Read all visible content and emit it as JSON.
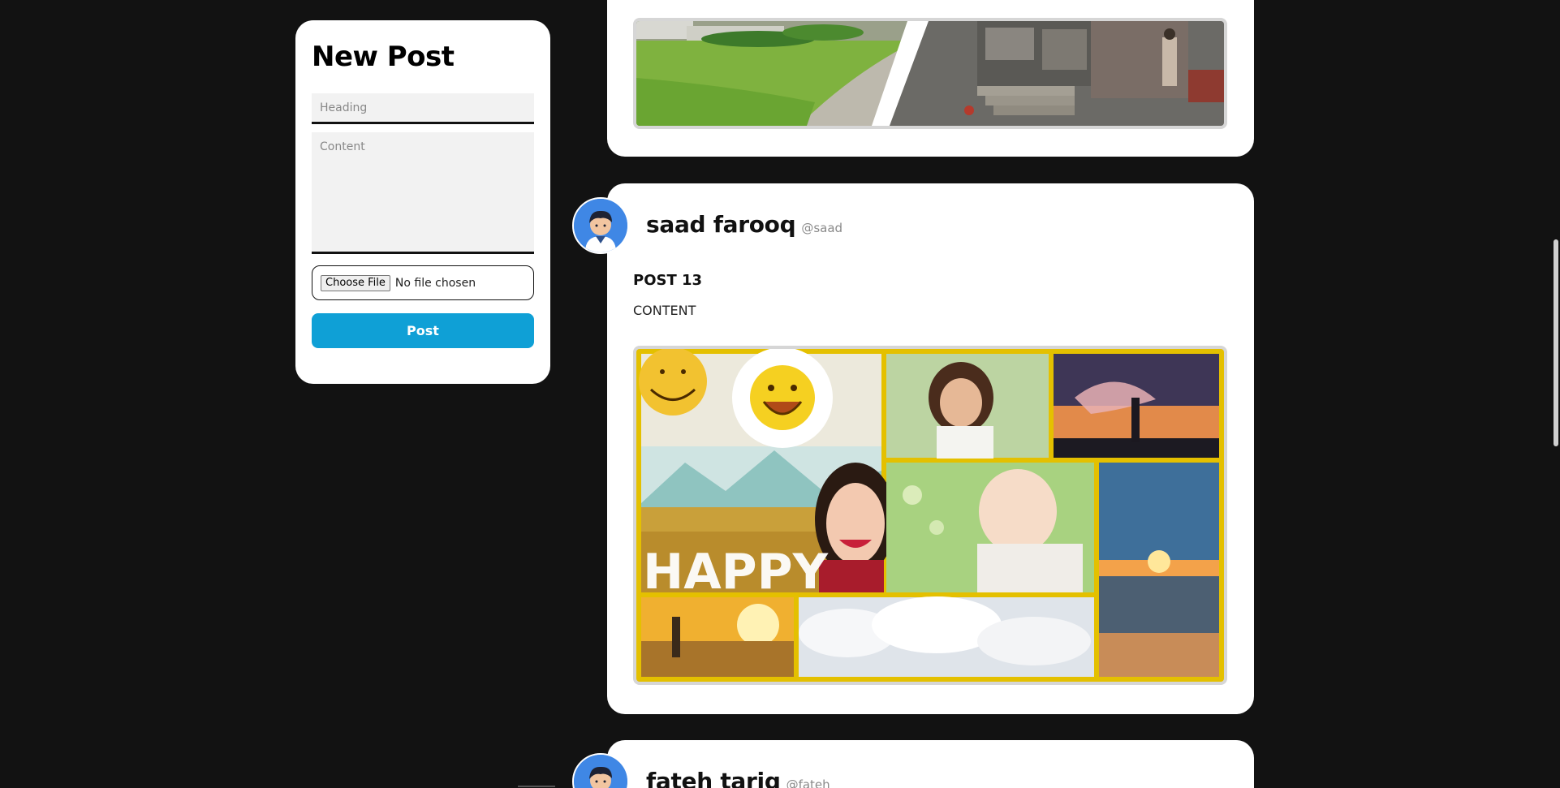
{
  "new_post": {
    "title": "New Post",
    "heading_placeholder": "Heading",
    "content_placeholder": "Content",
    "file_button_label": "Choose File",
    "file_status": "No file chosen",
    "post_button_label": "Post"
  },
  "feed": {
    "posts": [
      {
        "author_name": "saad farooq",
        "author_handle": "@saad",
        "heading": "POST 13",
        "content": "CONTENT",
        "image_caption_text": "HAPPY"
      },
      {
        "author_name": "fateh tariq",
        "author_handle": "@fateh"
      }
    ]
  },
  "colors": {
    "page_background": "#121212",
    "card_background": "#ffffff",
    "post_button": "#0fa0d6",
    "avatar_background": "#3f87e5",
    "collage_border": "#e4c000"
  },
  "icons": {
    "avatar": "user-avatar-icon"
  }
}
